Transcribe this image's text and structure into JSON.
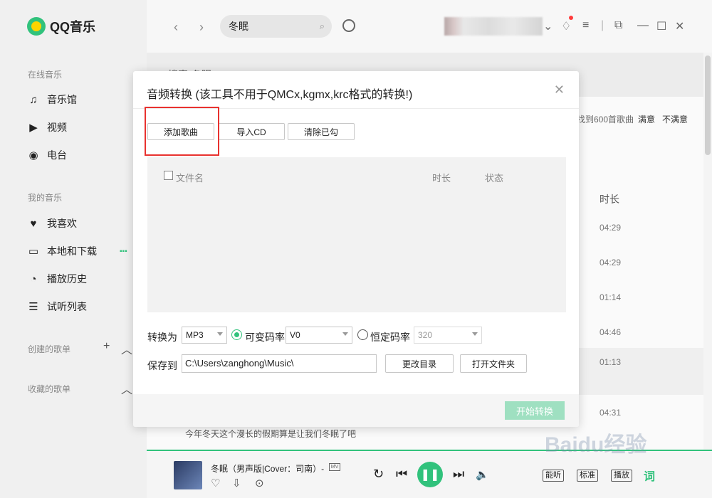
{
  "app": {
    "name": "QQ音乐"
  },
  "sidebar": {
    "online_title": "在线音乐",
    "online_items": [
      {
        "label": "音乐馆",
        "icon": "music-note-icon"
      },
      {
        "label": "视频",
        "icon": "video-icon"
      },
      {
        "label": "电台",
        "icon": "radio-icon"
      }
    ],
    "mine_title": "我的音乐",
    "mine_items": [
      {
        "label": "我喜欢",
        "icon": "heart-icon"
      },
      {
        "label": "本地和下载",
        "icon": "monitor-icon"
      },
      {
        "label": "播放历史",
        "icon": "history-icon"
      },
      {
        "label": "试听列表",
        "icon": "playlist-icon"
      }
    ],
    "created_title": "创建的歌单",
    "collected_title": "收藏的歌单"
  },
  "topbar": {
    "search_value": "冬眠"
  },
  "background": {
    "header_text": "搜索\"冬眠\"",
    "found_text": "找到600首歌曲",
    "satisfied": "满意",
    "unsatisfied": "不满意",
    "duration_header": "时长",
    "durations": [
      "04:29",
      "04:29",
      "01:14",
      "04:46",
      "01:13",
      "04:31"
    ],
    "lyric_line": "今年冬天这个漫长的假期算是让我们冬眠了吧"
  },
  "dialog": {
    "title": "音频转换 (该工具不用于QMCx,kgmx,krc格式的转换!)",
    "add_button": "添加歌曲",
    "import_cd_button": "导入CD",
    "clear_button": "清除已勾",
    "col_filename": "文件名",
    "col_duration": "时长",
    "col_status": "状态",
    "convert_label": "转换为",
    "format_value": "MP3",
    "vbr_label": "可变码率",
    "vbr_value": "V0",
    "cbr_label": "恒定码率",
    "cbr_value": "320",
    "save_label": "保存到",
    "save_path": "C:\\Users\\zanghong\\Music\\",
    "change_dir_button": "更改目录",
    "open_folder_button": "打开文件夹",
    "start_button": "开始转换"
  },
  "player": {
    "song": "冬眠（男声版|Cover：司南）-",
    "mv_badge": "MV",
    "tag_quality": "能听",
    "tag_effect": "标准",
    "tag_count": "播放",
    "lyric_btn": "词"
  },
  "watermark": "Baidu经验",
  "colors": {
    "accent": "#31c27c",
    "highlight": "#e8322f"
  }
}
